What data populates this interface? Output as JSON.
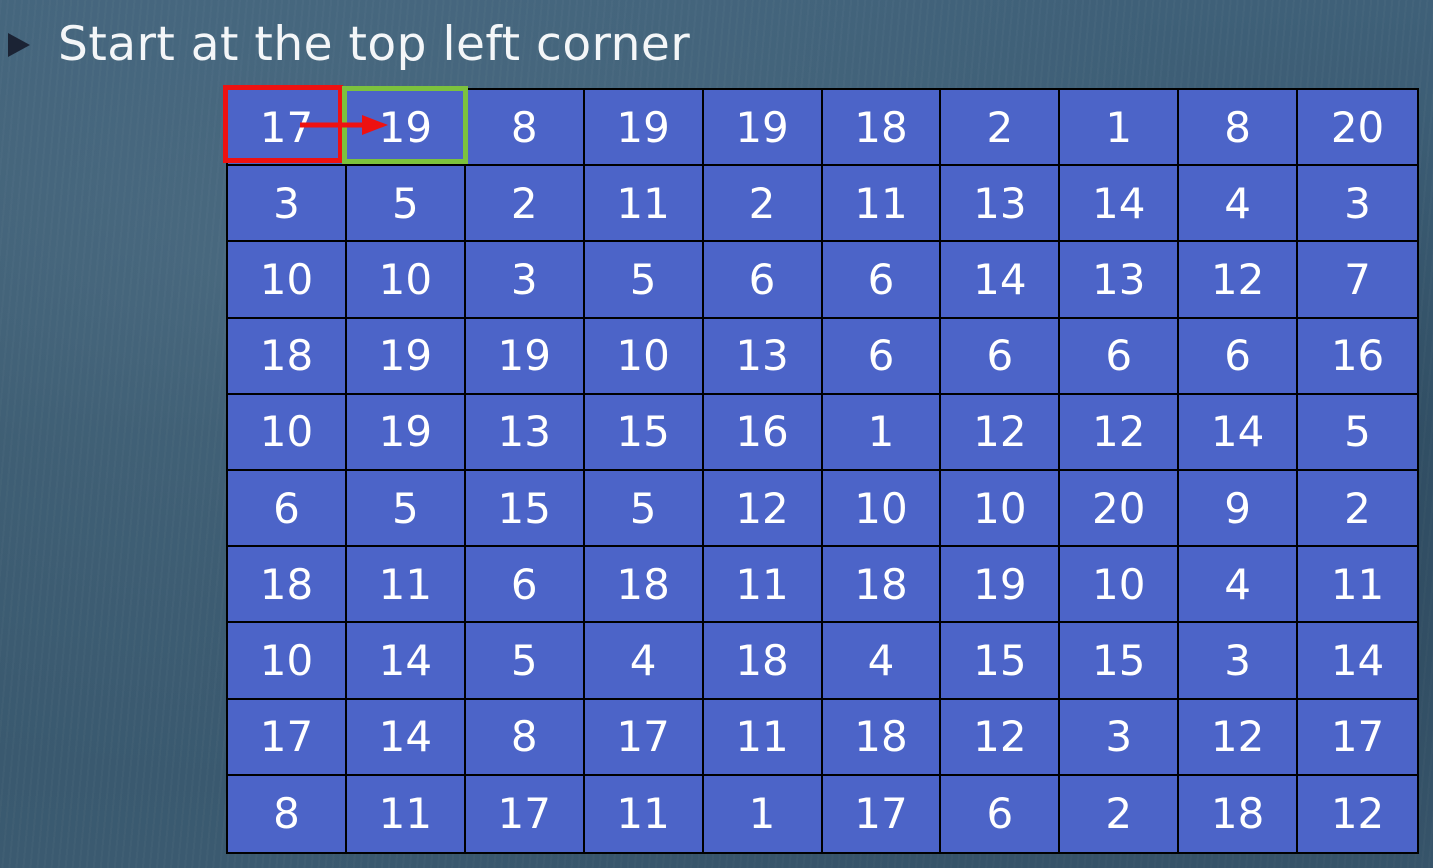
{
  "slide": {
    "bullet_text": "Start at the top left corner"
  },
  "grid": {
    "rows": [
      [
        "17",
        "19",
        "8",
        "19",
        "19",
        "18",
        "2",
        "1",
        "8",
        "20"
      ],
      [
        "3",
        "5",
        "2",
        "11",
        "2",
        "11",
        "13",
        "14",
        "4",
        "3"
      ],
      [
        "10",
        "10",
        "3",
        "5",
        "6",
        "6",
        "14",
        "13",
        "12",
        "7"
      ],
      [
        "18",
        "19",
        "19",
        "10",
        "13",
        "6",
        "6",
        "6",
        "6",
        "16"
      ],
      [
        "10",
        "19",
        "13",
        "15",
        "16",
        "1",
        "12",
        "12",
        "14",
        "5"
      ],
      [
        "6",
        "5",
        "15",
        "5",
        "12",
        "10",
        "10",
        "20",
        "9",
        "2"
      ],
      [
        "18",
        "11",
        "6",
        "18",
        "11",
        "18",
        "19",
        "10",
        "4",
        "11"
      ],
      [
        "10",
        "14",
        "5",
        "4",
        "18",
        "4",
        "15",
        "15",
        "3",
        "14"
      ],
      [
        "17",
        "14",
        "8",
        "17",
        "11",
        "18",
        "12",
        "3",
        "12",
        "17"
      ],
      [
        "8",
        "11",
        "17",
        "11",
        "1",
        "17",
        "6",
        "2",
        "18",
        "12"
      ]
    ],
    "highlights": {
      "current": {
        "row": 0,
        "col": 0,
        "color": "#ee1111"
      },
      "next": {
        "row": 0,
        "col": 1,
        "color": "#7cc23d"
      },
      "arrow_direction": "right"
    }
  },
  "colors": {
    "cell_fill": "#4c64c8",
    "cell_text": "#ffffff",
    "background": "#3a5a72",
    "bullet_marker": "#1b2334"
  }
}
